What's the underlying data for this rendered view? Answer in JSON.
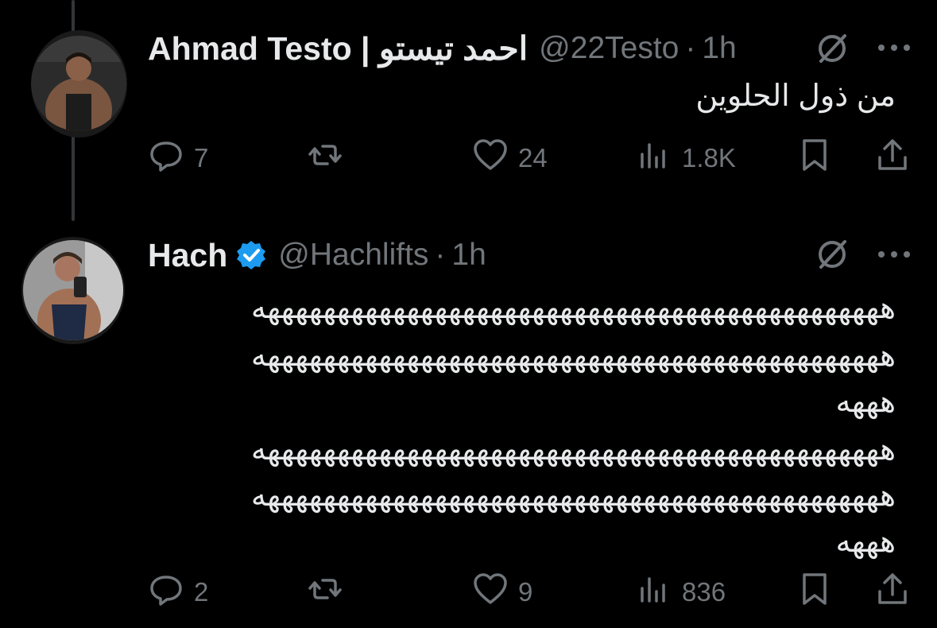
{
  "tweets": [
    {
      "name": "Ahmad Testo | احمد تيستو",
      "handle": "@22Testo",
      "separator": "·",
      "time": "1h",
      "text": "من ذول الحلوين",
      "actions": {
        "replies": "7",
        "reposts": "",
        "likes": "24",
        "views": "1.8K"
      }
    },
    {
      "name": "Hach",
      "verified": true,
      "handle": "@Hachlifts",
      "separator": "·",
      "time": "1h",
      "text_lines": [
        "هههههههههههههههههههههههههههههههههههههههههههههه",
        "هههههههههههههههههههههههههههههههههههههههههههههه",
        "هههه",
        "هههههههههههههههههههههههههههههههههههههههههههههه",
        "هههههههههههههههههههههههههههههههههههههههههههههه",
        "هههه"
      ],
      "actions": {
        "replies": "2",
        "reposts": "",
        "likes": "9",
        "views": "836"
      }
    }
  ],
  "colors": {
    "background": "#000000",
    "text": "#e7e9ea",
    "muted": "#71767b",
    "verified": "#1d9bf0",
    "thread_line": "#333639"
  },
  "icons": [
    "reply-icon",
    "repost-icon",
    "like-icon",
    "views-icon",
    "bookmark-icon",
    "share-icon",
    "grok-icon",
    "more-icon",
    "verified-badge-icon"
  ]
}
